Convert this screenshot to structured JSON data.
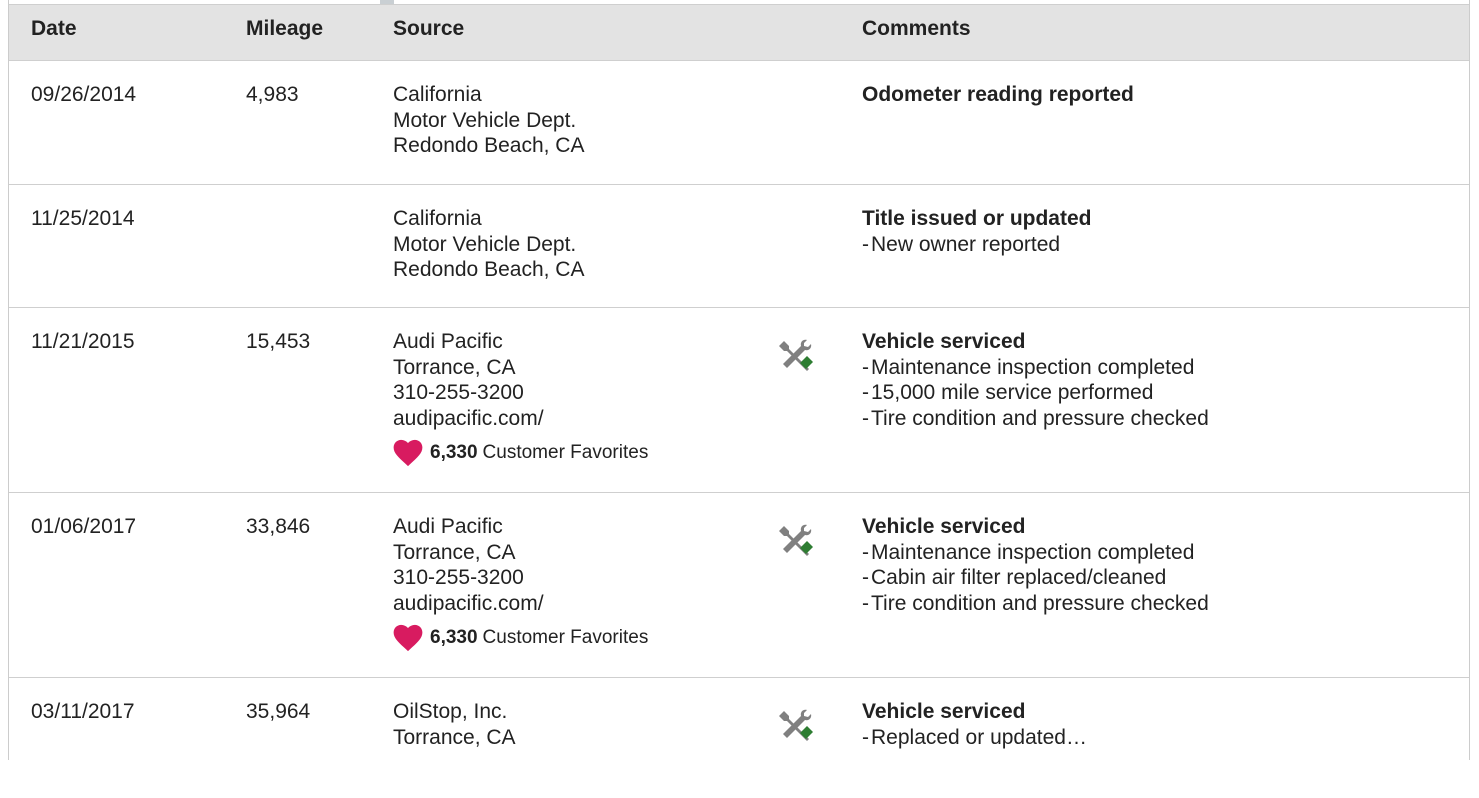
{
  "table": {
    "columns": {
      "date": "Date",
      "mileage": "Mileage",
      "source": "Source",
      "comments": "Comments"
    },
    "rows": [
      {
        "date": "09/26/2014",
        "mileage": "4,983",
        "source": [
          "California",
          "Motor Vehicle Dept.",
          "Redondo Beach, CA"
        ],
        "headline": "Odometer reading reported",
        "details": []
      },
      {
        "date": "11/25/2014",
        "mileage": "",
        "source": [
          "California",
          "Motor Vehicle Dept.",
          "Redondo Beach, CA"
        ],
        "headline": "Title issued or updated",
        "details": [
          "New owner reported"
        ]
      },
      {
        "date": "11/21/2015",
        "mileage": "15,453",
        "source": [
          "Audi Pacific",
          "Torrance, CA",
          "310-255-3200",
          "audipacific.com/"
        ],
        "favorites": {
          "count": "6,330",
          "label": "Customer Favorites"
        },
        "icon": "service-wrench-screwdriver-icon",
        "headline": "Vehicle serviced",
        "details": [
          "Maintenance inspection completed",
          "15,000 mile service performed",
          "Tire condition and pressure checked"
        ]
      },
      {
        "date": "01/06/2017",
        "mileage": "33,846",
        "source": [
          "Audi Pacific",
          "Torrance, CA",
          "310-255-3200",
          "audipacific.com/"
        ],
        "favorites": {
          "count": "6,330",
          "label": "Customer Favorites"
        },
        "icon": "service-wrench-screwdriver-icon",
        "headline": "Vehicle serviced",
        "details": [
          "Maintenance inspection completed",
          "Cabin air filter replaced/cleaned",
          "Tire condition and pressure checked"
        ]
      },
      {
        "date": "03/11/2017",
        "mileage": "35,964",
        "source": [
          "OilStop, Inc.",
          "Torrance, CA"
        ],
        "icon": "service-wrench-screwdriver-icon",
        "headline": "Vehicle serviced",
        "details": [
          "Replaced or updated…"
        ]
      }
    ]
  },
  "colors": {
    "header_bg": "#e3e3e3",
    "heart": "#d81b60",
    "icon_gray": "#808080",
    "icon_green": "#2e7d32",
    "divider": "#cfcfcf"
  }
}
